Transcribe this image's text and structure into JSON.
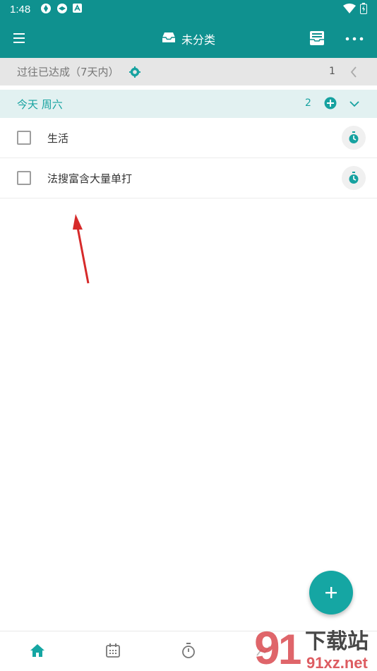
{
  "status_bar": {
    "time": "1:48",
    "icons": [
      "shutter-icon",
      "shutter-icon",
      "a-badge-icon",
      "wifi-icon",
      "battery-icon"
    ]
  },
  "app_bar": {
    "title": "未分类",
    "title_icon": "inbox-icon",
    "left_icon": "menu-icon",
    "right_icons": [
      "archive-icon",
      "more-icon"
    ]
  },
  "past_section": {
    "label": "过往已达成（7天内）",
    "count": "1",
    "icon": "gear-icon"
  },
  "today_section": {
    "label": "今天 周六",
    "count": "2"
  },
  "tasks": [
    {
      "label": "生活"
    },
    {
      "label": "法搜富含大量单打"
    }
  ],
  "watermark": {
    "text_cn": "下载站",
    "text_url": "91xz.net"
  },
  "colors": {
    "primary": "#0f918f",
    "accent": "#16a2a0",
    "fab": "#15a6a3",
    "annotation_arrow": "#d62a2a"
  }
}
